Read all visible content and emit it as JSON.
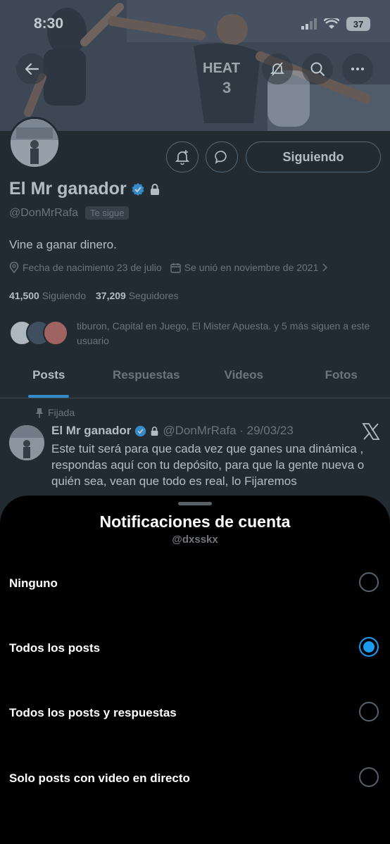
{
  "status_bar": {
    "time": "8:30",
    "battery": "37"
  },
  "header": {
    "back_icon": "arrow-left-icon",
    "icons": [
      "notifications-off-icon",
      "search-icon",
      "more-icon"
    ]
  },
  "profile": {
    "display_name": "El Mr ganador",
    "handle": "@DonMrRafa",
    "follows_you": "Te sigue",
    "bio": "Vine a ganar dinero.",
    "birthday": "Fecha de nacimiento 23 de julio",
    "joined": "Se unió en noviembre de 2021",
    "following_count": "41,500",
    "following_label": "Siguiendo",
    "followers_count": "37,209",
    "followers_label": "Seguidores",
    "known_followers": "tiburon, Capital en Juego, El Mister Apuesta. y 5 más siguen a este usuario",
    "follow_button": "Siguiendo",
    "accent": "#1d9bf0"
  },
  "tabs": [
    {
      "label": "Posts",
      "active": true
    },
    {
      "label": "Respuestas",
      "active": false
    },
    {
      "label": "Videos",
      "active": false
    },
    {
      "label": "Fotos",
      "active": false
    }
  ],
  "pinned_tweet": {
    "pinned_label": "Fijada",
    "name": "El Mr ganador",
    "handle_date": "@DonMrRafa · 29/03/23",
    "text": "Este tuit será para que cada vez que ganes una dinámica , respondas aquí con tu depósito, para que la gente nueva o quién sea, vean que todo es real, lo Fijaremos"
  },
  "sheet": {
    "title": "Notificaciones de cuenta",
    "subtitle": "@dxsskx",
    "options": [
      {
        "label": "Ninguno",
        "selected": false
      },
      {
        "label": "Todos los posts",
        "selected": true
      },
      {
        "label": "Todos los posts y respuestas",
        "selected": false
      },
      {
        "label": "Solo posts con video en directo",
        "selected": false
      }
    ]
  }
}
